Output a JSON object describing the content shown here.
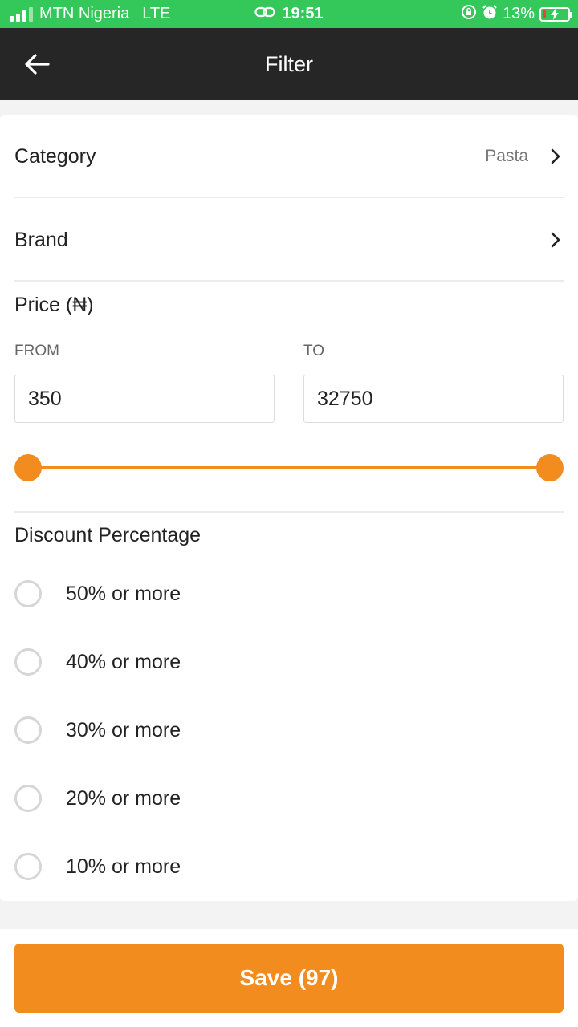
{
  "status_bar": {
    "carrier": "MTN Nigeria",
    "network": "LTE",
    "time": "19:51",
    "battery": "13%"
  },
  "header": {
    "title": "Filter",
    "back_icon": "arrow-left-icon"
  },
  "filters": {
    "category": {
      "label": "Category",
      "value": "Pasta"
    },
    "brand": {
      "label": "Brand",
      "value": ""
    },
    "price": {
      "title": "Price (₦)",
      "from_label": "FROM",
      "to_label": "TO",
      "from_value": "350",
      "to_value": "32750",
      "slider_min_fraction": 0,
      "slider_max_fraction": 1
    },
    "discount": {
      "title": "Discount Percentage",
      "options": [
        {
          "label": "50% or more",
          "selected": false
        },
        {
          "label": "40% or more",
          "selected": false
        },
        {
          "label": "30% or more",
          "selected": false
        },
        {
          "label": "20% or more",
          "selected": false
        },
        {
          "label": "10% or more",
          "selected": false
        }
      ]
    }
  },
  "footer": {
    "save_label": "Save (97)"
  },
  "colors": {
    "accent": "#f28c1e",
    "status_bar": "#34c759",
    "nav_bar": "#262626"
  }
}
